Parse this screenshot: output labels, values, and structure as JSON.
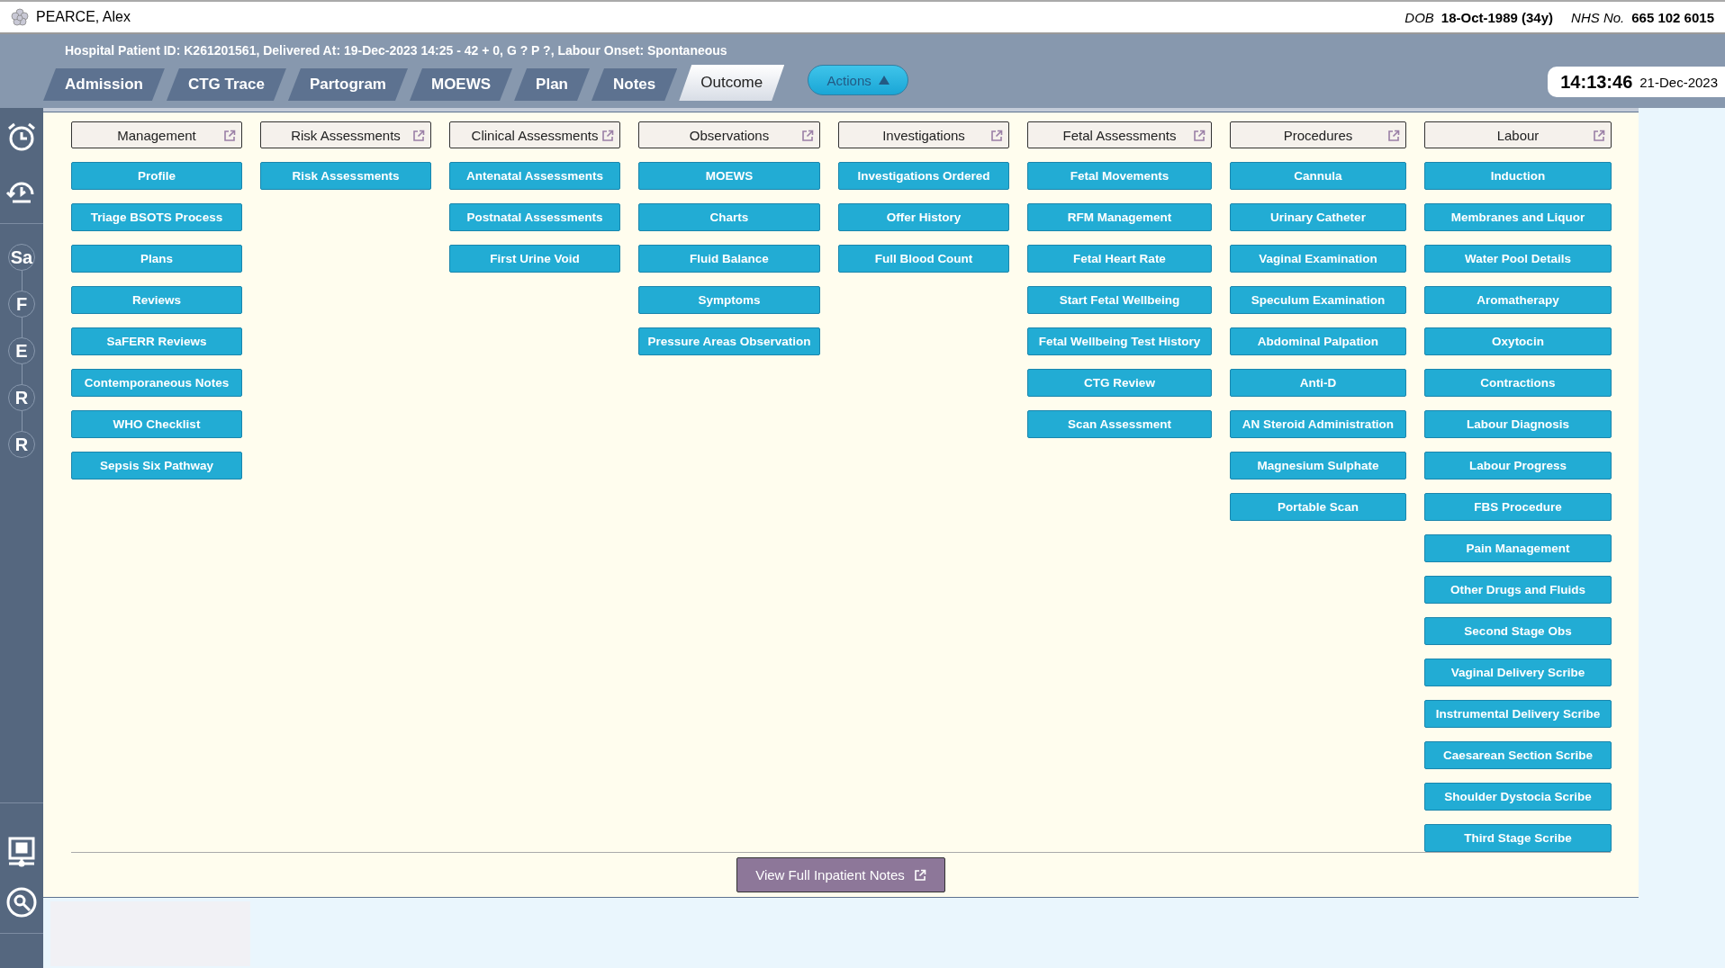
{
  "patient": {
    "name": "PEARCE, Alex",
    "dob_label": "DOB",
    "dob": "18-Oct-1989 (34y)",
    "nhs_label": "NHS No.",
    "nhs": "665 102 6015"
  },
  "info_line": "Hospital Patient ID: K261201561, Delivered At: 19-Dec-2023 14:25 - 42 + 0, G ? P ?,   Labour Onset: Spontaneous",
  "tabs": [
    {
      "label": "Admission",
      "selected": false
    },
    {
      "label": "CTG Trace",
      "selected": false
    },
    {
      "label": "Partogram",
      "selected": false
    },
    {
      "label": "MOEWS",
      "selected": false
    },
    {
      "label": "Plan",
      "selected": false
    },
    {
      "label": "Notes",
      "selected": false
    },
    {
      "label": "Outcome",
      "selected": true
    }
  ],
  "actions_button": "Actions",
  "clock": {
    "time": "14:13:46",
    "date": "21-Dec-2023"
  },
  "sidebar": {
    "steps": [
      "Sa",
      "F",
      "E",
      "R",
      "R"
    ]
  },
  "columns": [
    {
      "header": "Management",
      "buttons": [
        "Profile",
        "Triage BSOTS Process",
        "Plans",
        "Reviews",
        "SaFERR Reviews",
        "Contemporaneous Notes",
        "WHO Checklist",
        "Sepsis Six Pathway"
      ]
    },
    {
      "header": "Risk Assessments",
      "buttons": [
        "Risk Assessments"
      ]
    },
    {
      "header": "Clinical Assessments",
      "buttons": [
        "Antenatal Assessments",
        "Postnatal Assessments",
        "First Urine Void"
      ]
    },
    {
      "header": "Observations",
      "buttons": [
        "MOEWS",
        "Charts",
        "Fluid Balance",
        "Symptoms",
        "Pressure Areas Observation"
      ]
    },
    {
      "header": "Investigations",
      "buttons": [
        "Investigations Ordered",
        "Offer History",
        "Full Blood Count"
      ]
    },
    {
      "header": "Fetal Assessments",
      "buttons": [
        "Fetal Movements",
        "RFM Management",
        "Fetal Heart Rate",
        "Start Fetal Wellbeing",
        "Fetal Wellbeing Test History",
        "CTG Review",
        "Scan Assessment"
      ]
    },
    {
      "header": "Procedures",
      "buttons": [
        "Cannula",
        "Urinary Catheter",
        "Vaginal Examination",
        "Speculum Examination",
        "Abdominal Palpation",
        "Anti-D",
        "AN Steroid Administration",
        "Magnesium Sulphate",
        "Portable Scan"
      ]
    },
    {
      "header": "Labour",
      "buttons": [
        "Induction",
        "Membranes and Liquor",
        "Water Pool Details",
        "Aromatherapy",
        "Oxytocin",
        "Contractions",
        "Labour Diagnosis",
        "Labour Progress",
        "FBS Procedure",
        "Pain Management",
        "Other Drugs and Fluids",
        "Second Stage Obs",
        "Vaginal Delivery Scribe",
        "Instrumental Delivery Scribe",
        "Caesarean Section Scribe",
        "Shoulder Dystocia Scribe",
        "Third Stage Scribe"
      ]
    }
  ],
  "footer_button": "View Full Inpatient Notes"
}
